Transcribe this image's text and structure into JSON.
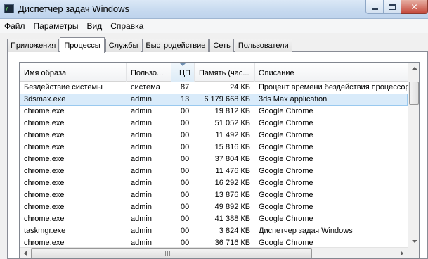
{
  "window": {
    "title": "Диспетчер задач Windows",
    "close_glyph": "✕"
  },
  "menu": [
    {
      "label": "Файл"
    },
    {
      "label": "Параметры"
    },
    {
      "label": "Вид"
    },
    {
      "label": "Справка"
    }
  ],
  "tabs": [
    {
      "label": "Приложения",
      "active": false
    },
    {
      "label": "Процессы",
      "active": true
    },
    {
      "label": "Службы",
      "active": false
    },
    {
      "label": "Быстродействие",
      "active": false
    },
    {
      "label": "Сеть",
      "active": false
    },
    {
      "label": "Пользователи",
      "active": false
    }
  ],
  "columns": {
    "name": "Имя образа",
    "user": "Пользо...",
    "cpu": "ЦП",
    "memory": "Память (час...",
    "description": "Описание"
  },
  "rows": [
    {
      "name": "Бездействие системы",
      "user": "система",
      "cpu": "87",
      "memory": "24 КБ",
      "description": "Процент времени бездействия процессор",
      "selected": false
    },
    {
      "name": "3dsmax.exe",
      "user": "admin",
      "cpu": "13",
      "memory": "6 179 668 КБ",
      "description": "3ds Max application",
      "selected": true
    },
    {
      "name": "chrome.exe",
      "user": "admin",
      "cpu": "00",
      "memory": "19 812 КБ",
      "description": "Google Chrome",
      "selected": false
    },
    {
      "name": "chrome.exe",
      "user": "admin",
      "cpu": "00",
      "memory": "51 052 КБ",
      "description": "Google Chrome",
      "selected": false
    },
    {
      "name": "chrome.exe",
      "user": "admin",
      "cpu": "00",
      "memory": "11 492 КБ",
      "description": "Google Chrome",
      "selected": false
    },
    {
      "name": "chrome.exe",
      "user": "admin",
      "cpu": "00",
      "memory": "15 816 КБ",
      "description": "Google Chrome",
      "selected": false
    },
    {
      "name": "chrome.exe",
      "user": "admin",
      "cpu": "00",
      "memory": "37 804 КБ",
      "description": "Google Chrome",
      "selected": false
    },
    {
      "name": "chrome.exe",
      "user": "admin",
      "cpu": "00",
      "memory": "11 476 КБ",
      "description": "Google Chrome",
      "selected": false
    },
    {
      "name": "chrome.exe",
      "user": "admin",
      "cpu": "00",
      "memory": "16 292 КБ",
      "description": "Google Chrome",
      "selected": false
    },
    {
      "name": "chrome.exe",
      "user": "admin",
      "cpu": "00",
      "memory": "13 876 КБ",
      "description": "Google Chrome",
      "selected": false
    },
    {
      "name": "chrome.exe",
      "user": "admin",
      "cpu": "00",
      "memory": "49 892 КБ",
      "description": "Google Chrome",
      "selected": false
    },
    {
      "name": "chrome.exe",
      "user": "admin",
      "cpu": "00",
      "memory": "41 388 КБ",
      "description": "Google Chrome",
      "selected": false
    },
    {
      "name": "taskmgr.exe",
      "user": "admin",
      "cpu": "00",
      "memory": "3 824 КБ",
      "description": "Диспетчер задач Windows",
      "selected": false
    },
    {
      "name": "chrome.exe",
      "user": "admin",
      "cpu": "00",
      "memory": "36 716 КБ",
      "description": "Google Chrome",
      "selected": false
    }
  ]
}
